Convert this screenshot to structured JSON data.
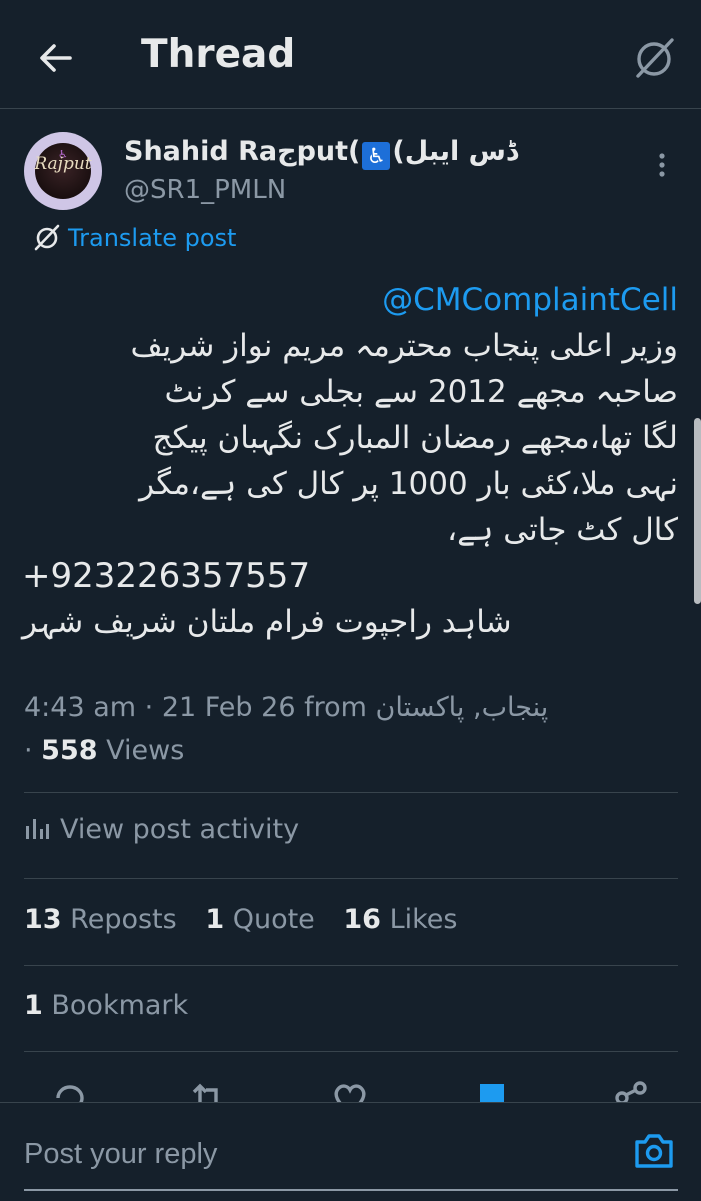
{
  "header": {
    "title": "Thread"
  },
  "post": {
    "display_name_before": "Shahid Ra",
    "display_name_mid": "ج",
    "display_name_after": "put(",
    "accessibility_glyph": "♿",
    "display_name_end": "ڈس ایبل)",
    "handle": "@SR1_PMLN",
    "avatar_text": "Rajput",
    "translate_label": "Translate post",
    "mention": "@CMComplaintCell",
    "lines": [
      "وزیر اعلی پنجاب محترمہ مریم نواز شریف",
      "صاحبہ مجھے 2012 سے بجلی سے کرنٹ",
      "لگا تھا،مجھے رمضان المبارک نگہبان پیکج",
      "نہی ملا،کئی بار 1000 پر کال کی ہے،مگر",
      "کال کٹ جاتی ہے،"
    ],
    "phone": "+923226357557",
    "signature": "شاہد راجپوت فرام ملتان شریف شہر",
    "time": "4:43 am",
    "date": "21 Feb 26",
    "from_label": "from",
    "location": "پنجاب, پاکستان",
    "views_count": "558",
    "views_label": "Views"
  },
  "activity": {
    "label": "View post activity"
  },
  "stats": {
    "reposts_count": "13",
    "reposts_label": "Reposts",
    "quotes_count": "1",
    "quotes_label": "Quote",
    "likes_count": "16",
    "likes_label": "Likes",
    "bookmarks_count": "1",
    "bookmarks_label": "Bookmark"
  },
  "reply": {
    "placeholder": "Post your reply"
  },
  "colors": {
    "background": "#15202b",
    "accent": "#1d9bf0",
    "muted": "#8b98a5",
    "divider": "#38444d"
  },
  "icons": [
    "back-arrow-icon",
    "translate-icon",
    "more-vertical-icon",
    "analytics-icon",
    "reply-icon",
    "repost-icon",
    "like-icon",
    "bookmark-icon",
    "share-icon",
    "camera-icon"
  ]
}
